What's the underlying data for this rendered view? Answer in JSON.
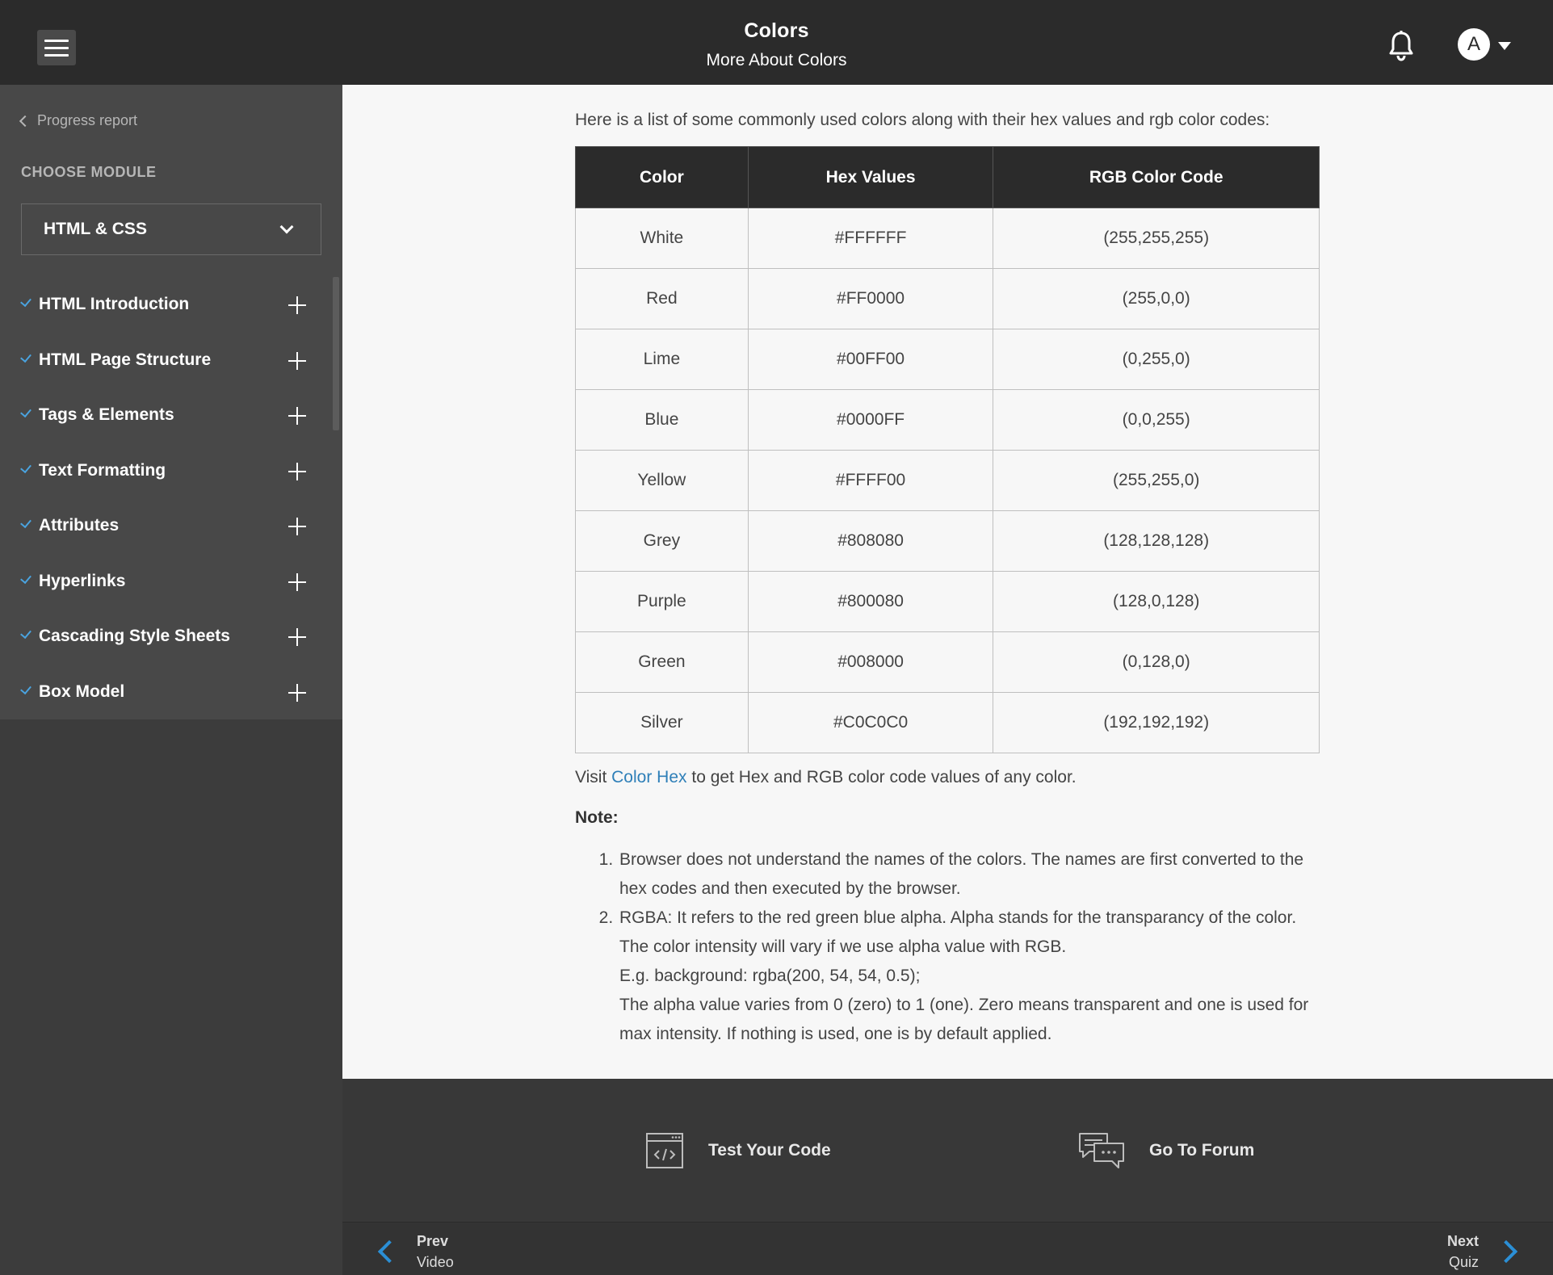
{
  "header": {
    "title": "Colors",
    "subtitle": "More About Colors",
    "avatar_letter": "A"
  },
  "sidebar": {
    "progress_link": "Progress report",
    "choose_module_label": "CHOOSE MODULE",
    "selected_module": "HTML & CSS",
    "items": [
      {
        "label": "HTML Introduction"
      },
      {
        "label": "HTML Page Structure"
      },
      {
        "label": "Tags & Elements"
      },
      {
        "label": "Text Formatting"
      },
      {
        "label": "Attributes"
      },
      {
        "label": "Hyperlinks"
      },
      {
        "label": "Cascading Style Sheets"
      },
      {
        "label": "Box Model"
      }
    ]
  },
  "main": {
    "intro": "Here is a list of some commonly used colors along with their hex values and rgb color codes:",
    "table": {
      "headers": [
        "Color",
        "Hex Values",
        "RGB Color Code"
      ],
      "rows": [
        [
          "White",
          "#FFFFFF",
          "(255,255,255)"
        ],
        [
          "Red",
          "#FF0000",
          "(255,0,0)"
        ],
        [
          "Lime",
          "#00FF00",
          "(0,255,0)"
        ],
        [
          "Blue",
          "#0000FF",
          "(0,0,255)"
        ],
        [
          "Yellow",
          "#FFFF00",
          "(255,255,0)"
        ],
        [
          "Grey",
          "#808080",
          "(128,128,128)"
        ],
        [
          "Purple",
          "#800080",
          "(128,0,128)"
        ],
        [
          "Green",
          "#008000",
          "(0,128,0)"
        ],
        [
          "Silver",
          "#C0C0C0",
          "(192,192,192)"
        ]
      ]
    },
    "visit_prefix": "Visit",
    "visit_link": "Color Hex",
    "visit_suffix": "to get Hex and RGB color code values of any color.",
    "note_title": "Note:",
    "notes": {
      "n1": "Browser does not understand the names of the colors. The names are first converted to the hex codes and then executed by the browser.",
      "n2_line1": "RGBA: It refers to the red green blue alpha. Alpha stands for the transparancy of the color. The color intensity will vary if we use alpha value with RGB.",
      "n2_line2": "E.g. background: rgba(200, 54, 54, 0.5);",
      "n2_line3": "The alpha value varies from 0 (zero) to 1 (one). Zero means transparent and one is used for max intensity. If nothing is used, one is by default applied."
    }
  },
  "actions": {
    "test_code": "Test Your Code",
    "forum": "Go To Forum"
  },
  "nav": {
    "prev_top": "Prev",
    "prev_bottom": "Video",
    "next_top": "Next",
    "next_bottom": "Quiz"
  },
  "colors": {
    "accent": "#2b8fd6",
    "link": "#2e7fb8",
    "check": "#4aa3df"
  },
  "icons": {
    "menu": "hamburger-icon",
    "bell": "bell-icon",
    "code": "code-window-icon",
    "forum": "chat-bubbles-icon"
  }
}
